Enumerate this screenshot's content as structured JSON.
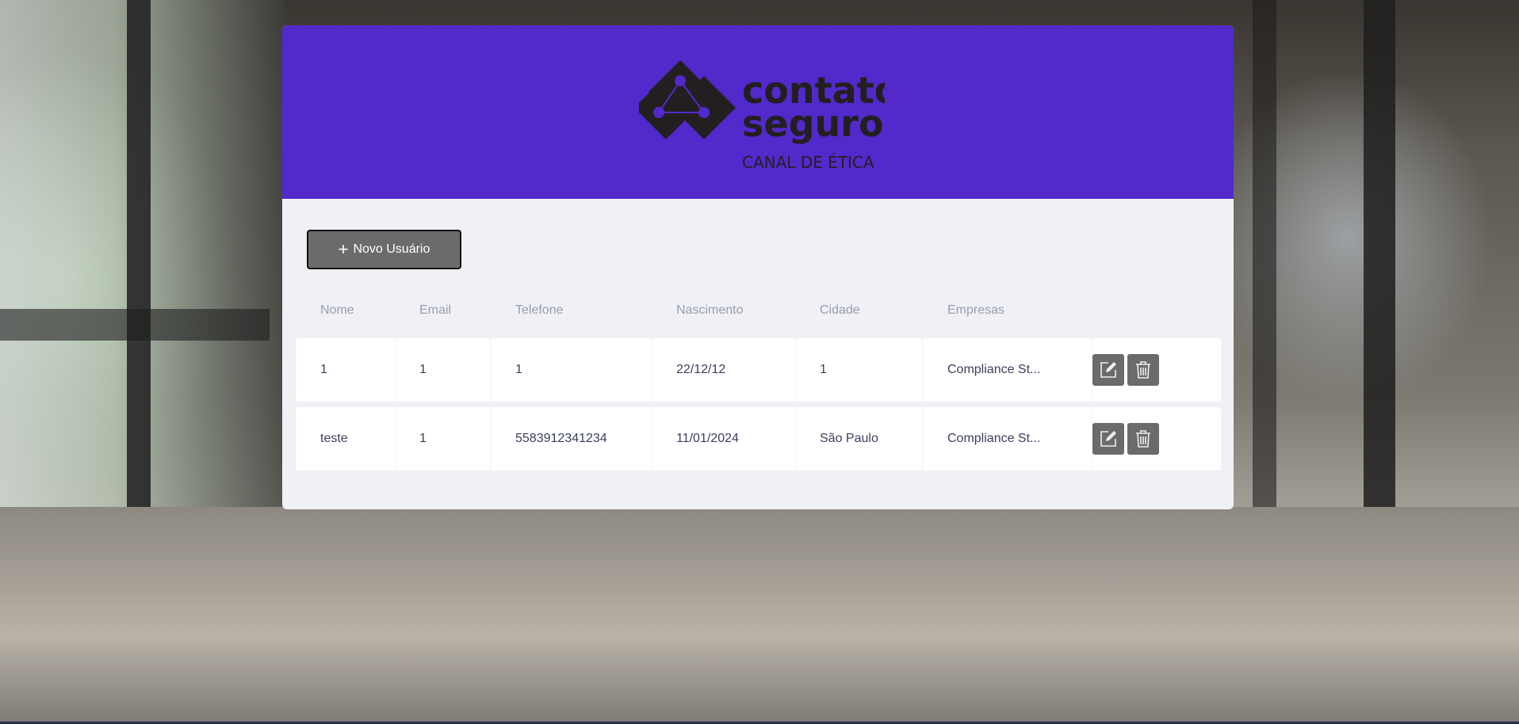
{
  "brand": {
    "name_line1": "contato",
    "name_line2": "seguro",
    "tagline": "CANAL DE ÉTICA",
    "header_color": "#5229cb"
  },
  "toolbar": {
    "new_user_label": "Novo Usuário",
    "new_user_icon": "plus-icon"
  },
  "table": {
    "columns": [
      "Nome",
      "Email",
      "Telefone",
      "Nascimento",
      "Cidade",
      "Empresas"
    ],
    "rows": [
      {
        "nome": "1",
        "email": "1",
        "telefone": "1",
        "nascimento": "22/12/12",
        "cidade": "1",
        "empresas": "Compliance St..."
      },
      {
        "nome": "teste",
        "email": "1",
        "telefone": "5583912341234",
        "nascimento": "11/01/2024",
        "cidade": "São Paulo",
        "empresas": "Compliance St..."
      }
    ],
    "actions": {
      "edit_icon": "edit-icon",
      "delete_icon": "trash-icon"
    }
  }
}
